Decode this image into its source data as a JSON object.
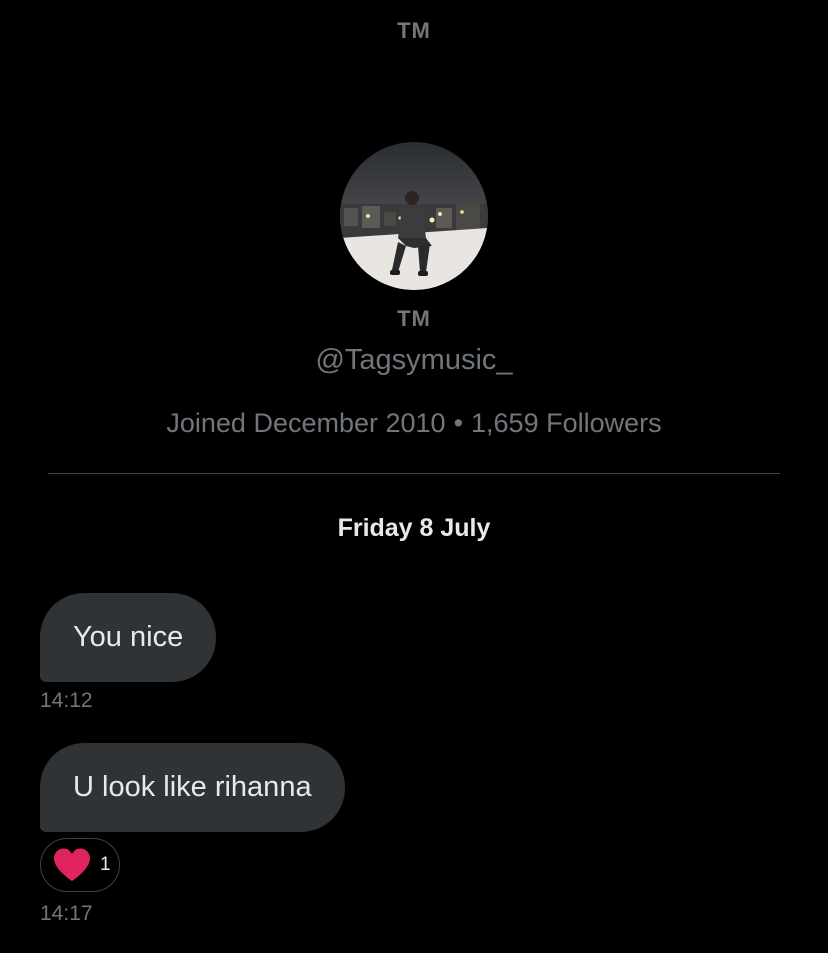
{
  "header": {
    "title": "TM"
  },
  "profile": {
    "display_name": "TM",
    "handle": "@Tagsymusic_",
    "joined": "Joined December 2010",
    "separator": "•",
    "followers": "1,659 Followers"
  },
  "conversation": {
    "date_separator": "Friday 8 July",
    "messages": [
      {
        "text": "You nice",
        "time": "14:12"
      },
      {
        "text": "U look like rihanna",
        "time": "14:17",
        "reaction": {
          "icon": "heart-icon",
          "count": "1",
          "color": "#e0245e"
        }
      }
    ]
  },
  "colors": {
    "background": "#000000",
    "bubble": "#2f3336",
    "muted_text": "#71767b",
    "primary_text": "#e7e9ea",
    "divider": "#3d4145"
  }
}
